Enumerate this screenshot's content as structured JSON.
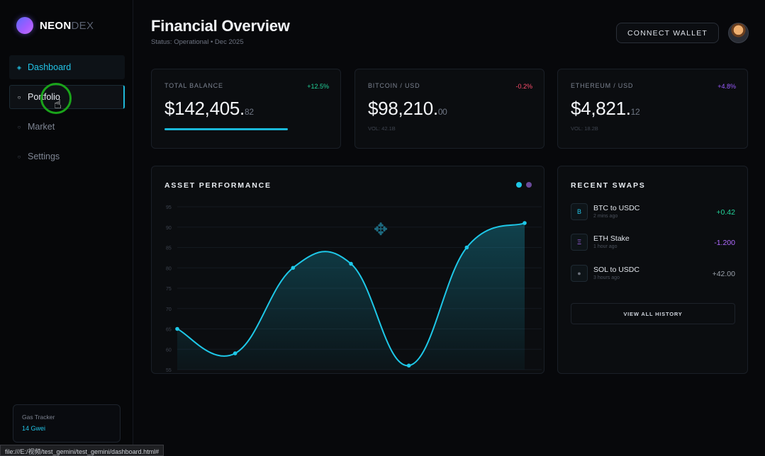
{
  "app": {
    "name_primary": "NEON",
    "name_secondary": "DEX"
  },
  "sidebar": {
    "items": [
      {
        "label": "Dashboard",
        "icon": "◈"
      },
      {
        "label": "Portfolio",
        "icon": "○"
      },
      {
        "label": "Market",
        "icon": "○"
      },
      {
        "label": "Settings",
        "icon": "○"
      }
    ],
    "gas": {
      "label": "Gas Tracker",
      "value": "14 Gwei"
    }
  },
  "header": {
    "title_light": "Financial ",
    "title_bold": "Overview",
    "subtitle": "Status: Operational • Dec 2025",
    "connect_label": "CONNECT WALLET"
  },
  "stats": [
    {
      "label": "TOTAL BALANCE",
      "change": "+12.5%",
      "change_color": "#22d39a",
      "value": "$142,405.",
      "cents": "82",
      "sub": "",
      "progress": 0.75
    },
    {
      "label": "BITCOIN / USD",
      "change": "-0.2%",
      "change_color": "#ff4d6d",
      "value": "$98,210.",
      "cents": "00",
      "sub": "VOL: 42.1B"
    },
    {
      "label": "ETHEREUM / USD",
      "change": "+4.8%",
      "change_color": "#9b5cff",
      "value": "$4,821.",
      "cents": "12",
      "sub": "VOL: 18.2B"
    }
  ],
  "performance": {
    "title": "ASSET PERFORMANCE",
    "legend_colors": [
      "#1ec8e8",
      "#6a4a9a"
    ]
  },
  "chart_data": {
    "type": "line",
    "title": "ASSET PERFORMANCE",
    "y_ticks": [
      "95",
      "90",
      "85",
      "80",
      "75",
      "70",
      "65",
      "60",
      "55"
    ],
    "ylim": [
      55,
      95
    ],
    "x": [
      0,
      1,
      2,
      3,
      4,
      5,
      6
    ],
    "series": [
      {
        "values": [
          65,
          59,
          80,
          81,
          56,
          85,
          91
        ]
      }
    ],
    "color": "#1ec8e8",
    "grid": true
  },
  "swaps": {
    "title": "RECENT SWAPS",
    "items": [
      {
        "icon": "B",
        "name": "BTC to USDC",
        "time": "2 mins ago",
        "amount": "+0.42",
        "color": "#22d39a",
        "icon_color": "#22c3e6"
      },
      {
        "icon": "Ξ",
        "name": "ETH Stake",
        "time": "1 hour ago",
        "amount": "-1.200",
        "color": "#b06bff",
        "icon_color": "#b06bff"
      },
      {
        "icon": "●",
        "name": "SOL to USDC",
        "time": "3 hours ago",
        "amount": "+42.00",
        "color": "#9aa0aa",
        "icon_color": "#6b707a"
      }
    ],
    "history_label": "VIEW ALL HISTORY"
  },
  "statusbar": {
    "text": "file:///E:/视频/test_gemini/test_gemini/dashboard.html#"
  }
}
